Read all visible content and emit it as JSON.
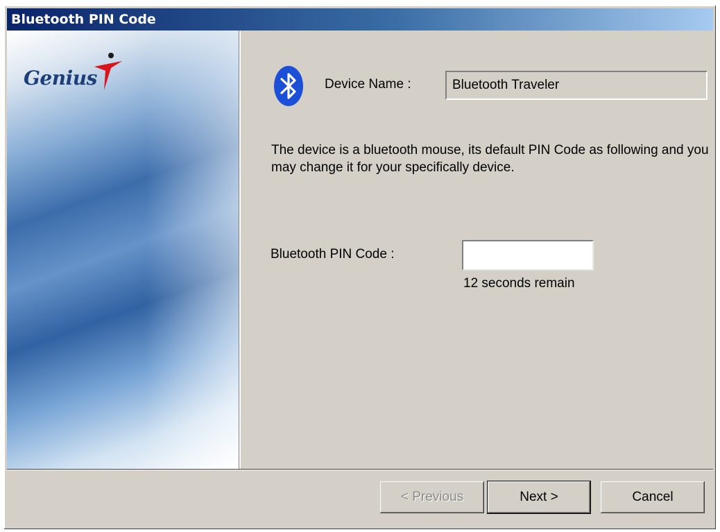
{
  "window": {
    "title": "Bluetooth PIN Code"
  },
  "side_panel": {
    "logo_text": "Genius"
  },
  "device": {
    "label": "Device Name :",
    "value": "Bluetooth Traveler"
  },
  "description": "The device is a bluetooth mouse, its default PIN Code as following and you may change it for your  specifically device.",
  "pin": {
    "label": "Bluetooth PIN Code :",
    "value": "",
    "countdown": "12 seconds remain"
  },
  "buttons": {
    "previous": "< Previous",
    "next": "Next >",
    "cancel": "Cancel"
  },
  "icons": {
    "bluetooth": "bluetooth-icon",
    "logo": "genius-logo-icon"
  },
  "colors": {
    "title_start": "#0a246a",
    "title_end": "#a6caf0",
    "dialog_bg": "#d4d0c8",
    "bluetooth_blue": "#1c4fd8",
    "logo_red": "#d8141c"
  }
}
